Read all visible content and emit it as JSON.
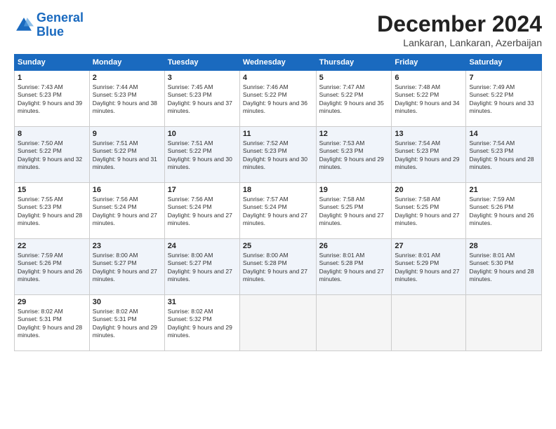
{
  "logo": {
    "line1": "General",
    "line2": "Blue"
  },
  "header": {
    "month": "December 2024",
    "location": "Lankaran, Lankaran, Azerbaijan"
  },
  "weekdays": [
    "Sunday",
    "Monday",
    "Tuesday",
    "Wednesday",
    "Thursday",
    "Friday",
    "Saturday"
  ],
  "weeks": [
    [
      {
        "day": "1",
        "sunrise": "7:43 AM",
        "sunset": "5:23 PM",
        "daylight": "9 hours and 39 minutes."
      },
      {
        "day": "2",
        "sunrise": "7:44 AM",
        "sunset": "5:23 PM",
        "daylight": "9 hours and 38 minutes."
      },
      {
        "day": "3",
        "sunrise": "7:45 AM",
        "sunset": "5:23 PM",
        "daylight": "9 hours and 37 minutes."
      },
      {
        "day": "4",
        "sunrise": "7:46 AM",
        "sunset": "5:22 PM",
        "daylight": "9 hours and 36 minutes."
      },
      {
        "day": "5",
        "sunrise": "7:47 AM",
        "sunset": "5:22 PM",
        "daylight": "9 hours and 35 minutes."
      },
      {
        "day": "6",
        "sunrise": "7:48 AM",
        "sunset": "5:22 PM",
        "daylight": "9 hours and 34 minutes."
      },
      {
        "day": "7",
        "sunrise": "7:49 AM",
        "sunset": "5:22 PM",
        "daylight": "9 hours and 33 minutes."
      }
    ],
    [
      {
        "day": "8",
        "sunrise": "7:50 AM",
        "sunset": "5:22 PM",
        "daylight": "9 hours and 32 minutes."
      },
      {
        "day": "9",
        "sunrise": "7:51 AM",
        "sunset": "5:22 PM",
        "daylight": "9 hours and 31 minutes."
      },
      {
        "day": "10",
        "sunrise": "7:51 AM",
        "sunset": "5:22 PM",
        "daylight": "9 hours and 30 minutes."
      },
      {
        "day": "11",
        "sunrise": "7:52 AM",
        "sunset": "5:23 PM",
        "daylight": "9 hours and 30 minutes."
      },
      {
        "day": "12",
        "sunrise": "7:53 AM",
        "sunset": "5:23 PM",
        "daylight": "9 hours and 29 minutes."
      },
      {
        "day": "13",
        "sunrise": "7:54 AM",
        "sunset": "5:23 PM",
        "daylight": "9 hours and 29 minutes."
      },
      {
        "day": "14",
        "sunrise": "7:54 AM",
        "sunset": "5:23 PM",
        "daylight": "9 hours and 28 minutes."
      }
    ],
    [
      {
        "day": "15",
        "sunrise": "7:55 AM",
        "sunset": "5:23 PM",
        "daylight": "9 hours and 28 minutes."
      },
      {
        "day": "16",
        "sunrise": "7:56 AM",
        "sunset": "5:24 PM",
        "daylight": "9 hours and 27 minutes."
      },
      {
        "day": "17",
        "sunrise": "7:56 AM",
        "sunset": "5:24 PM",
        "daylight": "9 hours and 27 minutes."
      },
      {
        "day": "18",
        "sunrise": "7:57 AM",
        "sunset": "5:24 PM",
        "daylight": "9 hours and 27 minutes."
      },
      {
        "day": "19",
        "sunrise": "7:58 AM",
        "sunset": "5:25 PM",
        "daylight": "9 hours and 27 minutes."
      },
      {
        "day": "20",
        "sunrise": "7:58 AM",
        "sunset": "5:25 PM",
        "daylight": "9 hours and 27 minutes."
      },
      {
        "day": "21",
        "sunrise": "7:59 AM",
        "sunset": "5:26 PM",
        "daylight": "9 hours and 26 minutes."
      }
    ],
    [
      {
        "day": "22",
        "sunrise": "7:59 AM",
        "sunset": "5:26 PM",
        "daylight": "9 hours and 26 minutes."
      },
      {
        "day": "23",
        "sunrise": "8:00 AM",
        "sunset": "5:27 PM",
        "daylight": "9 hours and 27 minutes."
      },
      {
        "day": "24",
        "sunrise": "8:00 AM",
        "sunset": "5:27 PM",
        "daylight": "9 hours and 27 minutes."
      },
      {
        "day": "25",
        "sunrise": "8:00 AM",
        "sunset": "5:28 PM",
        "daylight": "9 hours and 27 minutes."
      },
      {
        "day": "26",
        "sunrise": "8:01 AM",
        "sunset": "5:28 PM",
        "daylight": "9 hours and 27 minutes."
      },
      {
        "day": "27",
        "sunrise": "8:01 AM",
        "sunset": "5:29 PM",
        "daylight": "9 hours and 27 minutes."
      },
      {
        "day": "28",
        "sunrise": "8:01 AM",
        "sunset": "5:30 PM",
        "daylight": "9 hours and 28 minutes."
      }
    ],
    [
      {
        "day": "29",
        "sunrise": "8:02 AM",
        "sunset": "5:31 PM",
        "daylight": "9 hours and 28 minutes."
      },
      {
        "day": "30",
        "sunrise": "8:02 AM",
        "sunset": "5:31 PM",
        "daylight": "9 hours and 29 minutes."
      },
      {
        "day": "31",
        "sunrise": "8:02 AM",
        "sunset": "5:32 PM",
        "daylight": "9 hours and 29 minutes."
      },
      null,
      null,
      null,
      null
    ]
  ]
}
